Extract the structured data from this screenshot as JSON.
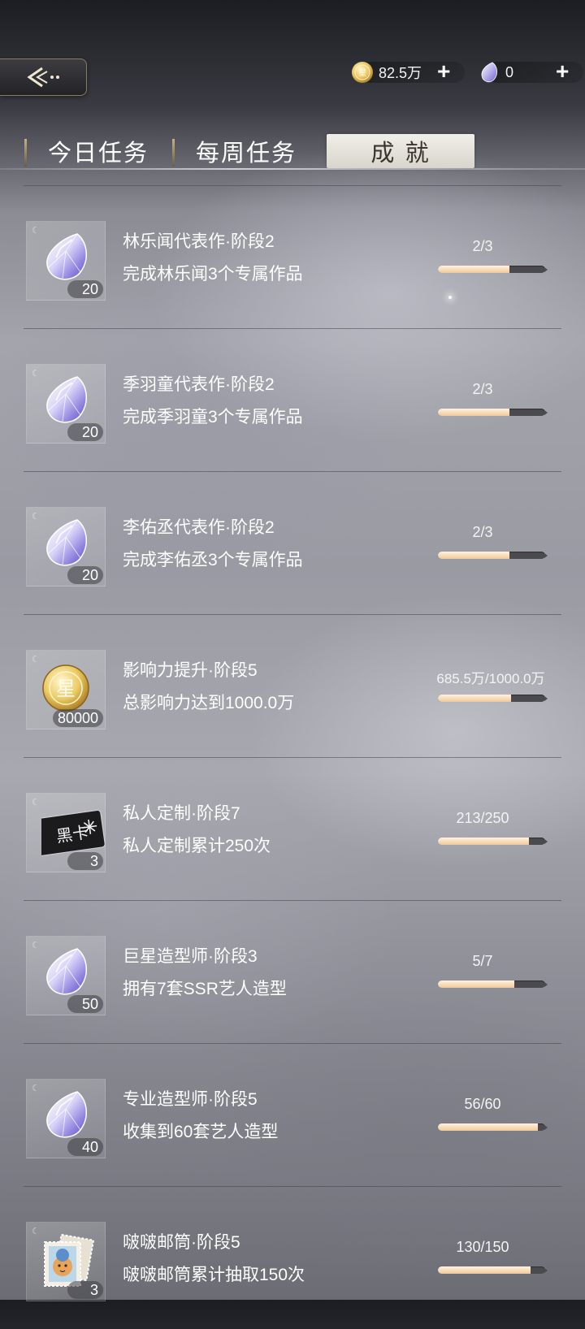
{
  "header": {
    "back_icon": "back-arrow-icon",
    "gold": {
      "icon": "star-coin-icon",
      "value": "82.5万",
      "plus": "+"
    },
    "gem": {
      "icon": "diamond-icon",
      "value": "0",
      "plus": "+"
    }
  },
  "tabs": [
    {
      "label": "今日任务",
      "active": false
    },
    {
      "label": "每周任务",
      "active": false
    },
    {
      "label": "成 就",
      "active": true
    }
  ],
  "achievements": [
    {
      "reward_icon": "diamond-icon",
      "reward_qty": "20",
      "title": "林乐闻代表作·阶段2",
      "desc": "完成林乐闻3个专属作品",
      "progress_text": "2/3",
      "progress": 0.667
    },
    {
      "reward_icon": "diamond-icon",
      "reward_qty": "20",
      "title": "季羽童代表作·阶段2",
      "desc": "完成季羽童3个专属作品",
      "progress_text": "2/3",
      "progress": 0.667
    },
    {
      "reward_icon": "diamond-icon",
      "reward_qty": "20",
      "title": "李佑丞代表作·阶段2",
      "desc": "完成李佑丞3个专属作品",
      "progress_text": "2/3",
      "progress": 0.667
    },
    {
      "reward_icon": "star-coin-icon",
      "reward_qty": "80000",
      "title": "影响力提升·阶段5",
      "desc": "总影响力达到1000.0万",
      "progress_text": "685.5万/1000.0万",
      "progress": 0.6855
    },
    {
      "reward_icon": "black-card-icon",
      "reward_qty": "3",
      "title": "私人定制·阶段7",
      "desc": "私人定制累计250次",
      "progress_text": "213/250",
      "progress": 0.852
    },
    {
      "reward_icon": "diamond-icon",
      "reward_qty": "50",
      "title": "巨星造型师·阶段3",
      "desc": "拥有7套SSR艺人造型",
      "progress_text": "5/7",
      "progress": 0.714
    },
    {
      "reward_icon": "diamond-icon",
      "reward_qty": "40",
      "title": "专业造型师·阶段5",
      "desc": "收集到60套艺人造型",
      "progress_text": "56/60",
      "progress": 0.933
    },
    {
      "reward_icon": "stamp-ticket-icon",
      "reward_qty": "3",
      "title": "啵啵邮筒·阶段5",
      "desc": "啵啵邮筒累计抽取150次",
      "progress_text": "130/150",
      "progress": 0.867
    }
  ]
}
